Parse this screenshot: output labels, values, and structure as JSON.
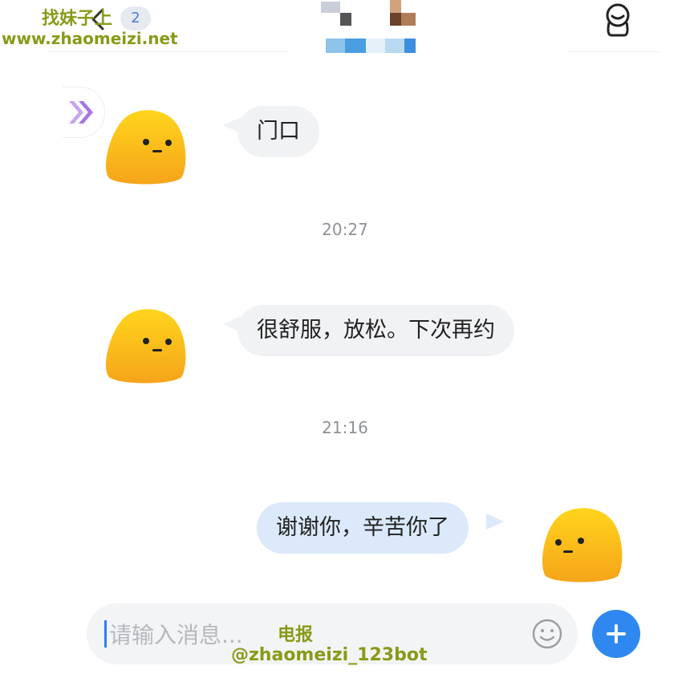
{
  "header": {
    "unread_count": "2"
  },
  "watermark": {
    "line1": "找妹子上",
    "line2": "www.zhaomeizi.net",
    "line3": "电报",
    "line4": "@zhaomeizi_123bot"
  },
  "messages": [
    {
      "direction": "incoming",
      "text": "门口"
    },
    {
      "direction": "incoming",
      "text": "很舒服，放松。下次再约"
    },
    {
      "direction": "outgoing",
      "text": "谢谢你，辛苦你了"
    }
  ],
  "timestamps": [
    "20:27",
    "21:16"
  ],
  "composer": {
    "placeholder": "请输入消息..."
  },
  "icons": {
    "back": "chevron-left-icon",
    "profile": "person-outline-icon",
    "emoji": "smiley-icon",
    "plus": "plus-icon",
    "side_badge": "double-chevron-right-icon",
    "avatar": "yellow-blob-avatar"
  },
  "colors": {
    "accent": "#2f88f0",
    "outgoing_bubble": "#dbe9fb",
    "incoming_bubble": "#f1f2f4",
    "avatar_top": "#ffd21a",
    "avatar_bottom": "#f7a21a",
    "watermark": "#8a9a18"
  }
}
